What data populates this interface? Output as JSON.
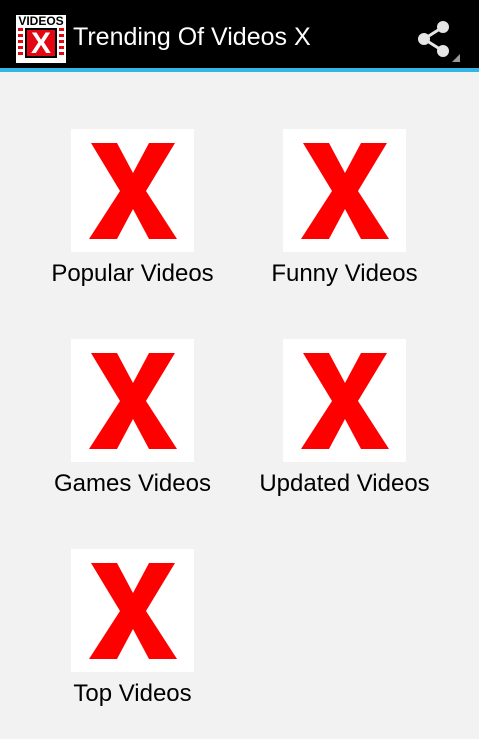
{
  "app": {
    "title": "Trending Of Videos X",
    "logo_top_text": "VIDEOS",
    "logo_letter": "X"
  },
  "action_icons": {
    "share": "share-icon"
  },
  "colors": {
    "action_bar": "#000000",
    "accent_line": "#33b5e5",
    "background": "#f2f2f2",
    "x_red": "#ff0000"
  },
  "categories": [
    {
      "label": "Popular Videos",
      "icon": "red-x-icon"
    },
    {
      "label": "Funny Videos",
      "icon": "red-x-icon"
    },
    {
      "label": "Games Videos",
      "icon": "red-x-icon"
    },
    {
      "label": "Updated Videos",
      "icon": "red-x-icon"
    },
    {
      "label": "Top Videos",
      "icon": "red-x-icon"
    }
  ]
}
